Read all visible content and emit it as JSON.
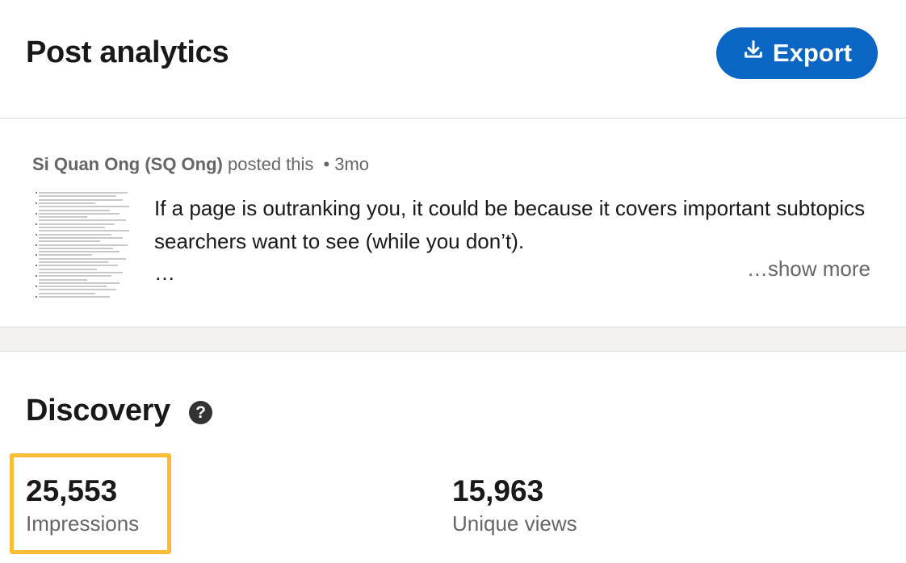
{
  "header": {
    "title": "Post analytics",
    "export_label": "Export",
    "export_icon": "download-icon",
    "accent_color": "#0a66c2"
  },
  "post": {
    "author": "Si Quan Ong (SQ Ong)",
    "action": "posted this",
    "separator": "•",
    "age": "3mo",
    "text": "If a page is outranking you, it could be because it covers important subtopics searchers want to see (while you don’t).",
    "ellipsis": "…",
    "show_more": "…show more"
  },
  "discovery": {
    "title": "Discovery",
    "help_icon": "question-circle-icon",
    "metrics": [
      {
        "value": "25,553",
        "label": "Impressions"
      },
      {
        "value": "15,963",
        "label": "Unique views"
      }
    ],
    "highlight_color": "#fbbd35"
  }
}
